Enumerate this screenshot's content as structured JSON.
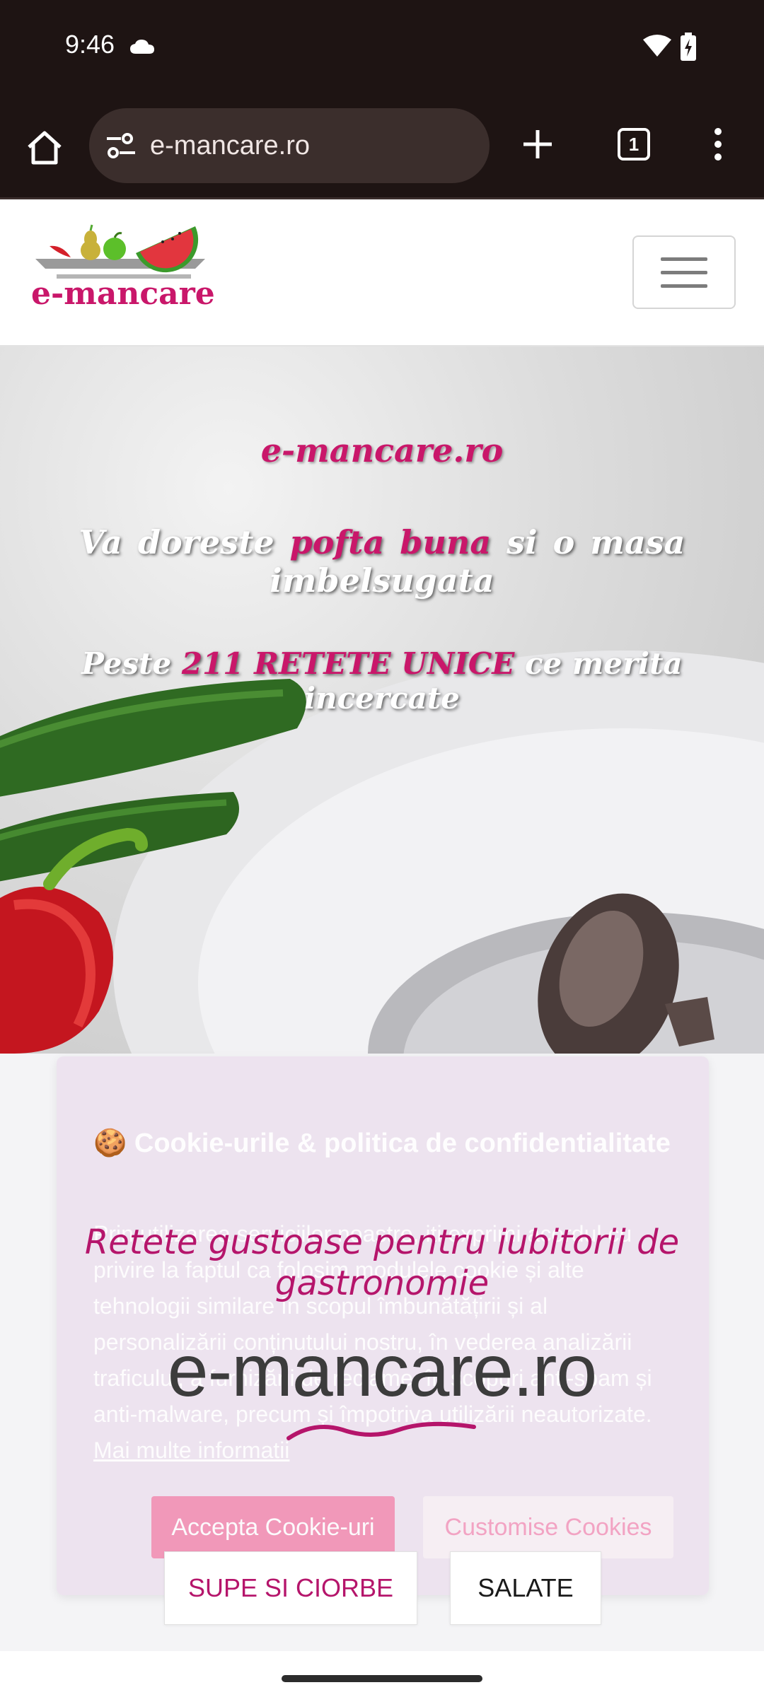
{
  "status_bar": {
    "time": "9:46"
  },
  "browser": {
    "url": "e-mancare.ro",
    "tab_count": "1"
  },
  "site": {
    "logo_text": "e-mancare"
  },
  "hero": {
    "title": "e-mancare.ro",
    "line1_before": "Va doreste ",
    "line1_highlight": "pofta buna",
    "line1_after": " si o masa imbelsugata",
    "line2_before": "Peste ",
    "line2_highlight": "211 RETETE UNICE",
    "line2_after": " ce merita incercate"
  },
  "cookie_dialog": {
    "title": "🍪 Cookie-urile & politica de confidentialitate",
    "body": "Prin utilizarea serviciilor noastre, iti exprimi acordul cu privire la faptul ca folosim modulele cookie și alte tehnologii similare în scopul îmbunătățirii și al personalizării conținutului nostru, în vederea analizării traficului, a furnizării de reclame, în scopuri anti-spam și anti-malware, precum și împotriva utilizării neautorizate.",
    "link": "Mai multe informatii",
    "accept_label": "Accepta Cookie-uri",
    "customise_label": "Customise Cookies"
  },
  "section": {
    "tagline": "Retete gustoase pentru iubitorii de gastronomie",
    "site_name": "e-mancare.ro",
    "categories": [
      "SUPE SI CIORBE",
      "SALATE"
    ]
  },
  "colors": {
    "brand": "#c9176a",
    "toolbar": "#1e1413"
  }
}
